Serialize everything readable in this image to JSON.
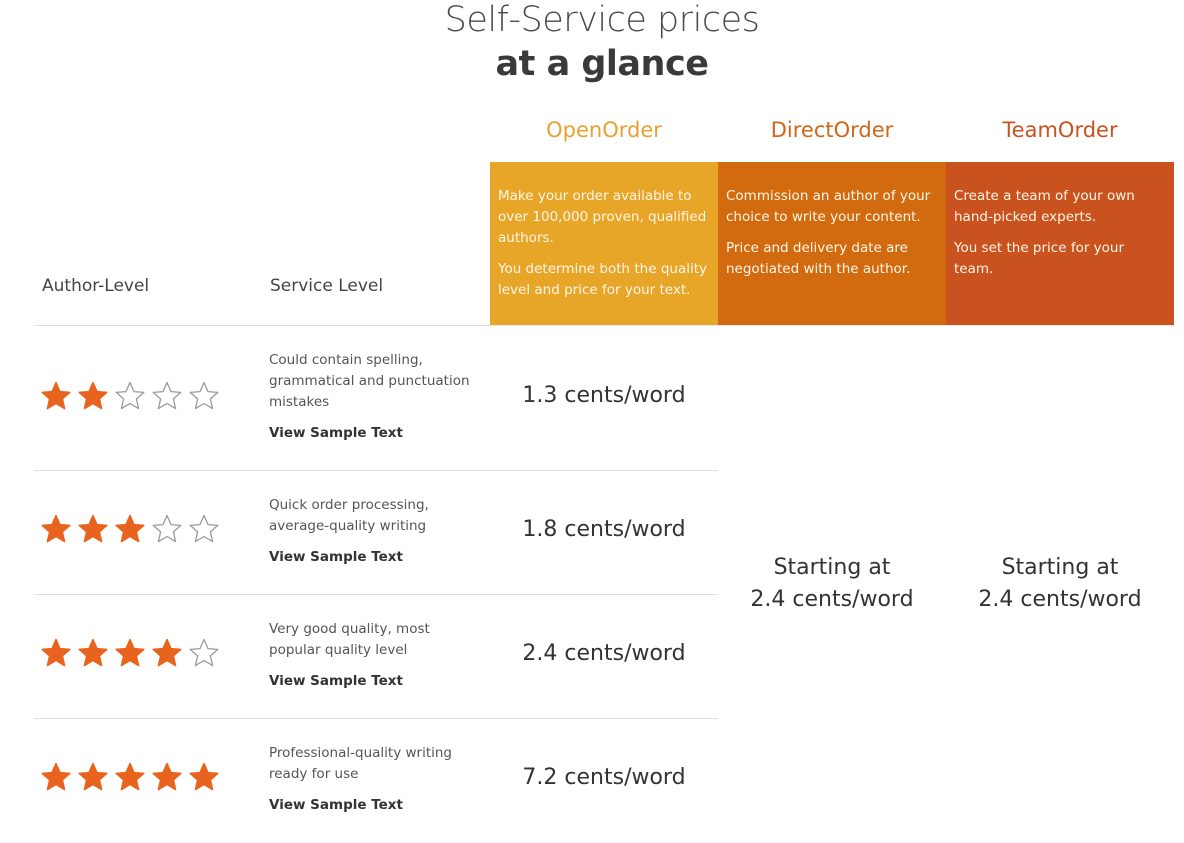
{
  "header": {
    "title_line1": "Self-Service prices",
    "title_line2": "at a glance"
  },
  "columns": [
    {
      "name": "OpenOrder",
      "color": "#E8A628",
      "title_color": "#E8A030",
      "description": [
        "Make your order available to over 100,000 proven, qualified authors.",
        "You determine both the quality level and price for your text."
      ]
    },
    {
      "name": "DirectOrder",
      "color": "#D26B0F",
      "title_color": "#D0661A",
      "description": [
        "Commission an author of your choice to write your content.",
        "Price and delivery date are negotiated with the author."
      ]
    },
    {
      "name": "TeamOrder",
      "color": "#C9521E",
      "title_color": "#C9521E",
      "description": [
        "Create a team of your own hand-picked experts.",
        "You set the price for your team."
      ]
    }
  ],
  "table": {
    "headers": {
      "author_level": "Author-Level",
      "service_level": "Service Level"
    },
    "star_color": "#E8641E",
    "star_empty_color": "#9a9a9a",
    "rows": [
      {
        "stars": 2,
        "stars_max": 5,
        "description": "Could contain spelling, grammatical and punctuation mistakes",
        "link": "View Sample Text",
        "open_order_price": "1.3 cents/word"
      },
      {
        "stars": 3,
        "stars_max": 5,
        "description": "Quick order processing, average-quality writing",
        "link": "View Sample Text",
        "open_order_price": "1.8 cents/word"
      },
      {
        "stars": 4,
        "stars_max": 5,
        "description": "Very good quality, most popular quality level",
        "link": "View Sample Text",
        "open_order_price": "2.4 cents/word"
      },
      {
        "stars": 5,
        "stars_max": 5,
        "description": "Professional-quality writing ready for use",
        "link": "View Sample Text",
        "open_order_price": "7.2 cents/word"
      }
    ],
    "direct_order_price": {
      "line1": "Starting at",
      "line2": "2.4 cents/word"
    },
    "team_order_price": {
      "line1": "Starting at",
      "line2": "2.4 cents/word"
    }
  }
}
